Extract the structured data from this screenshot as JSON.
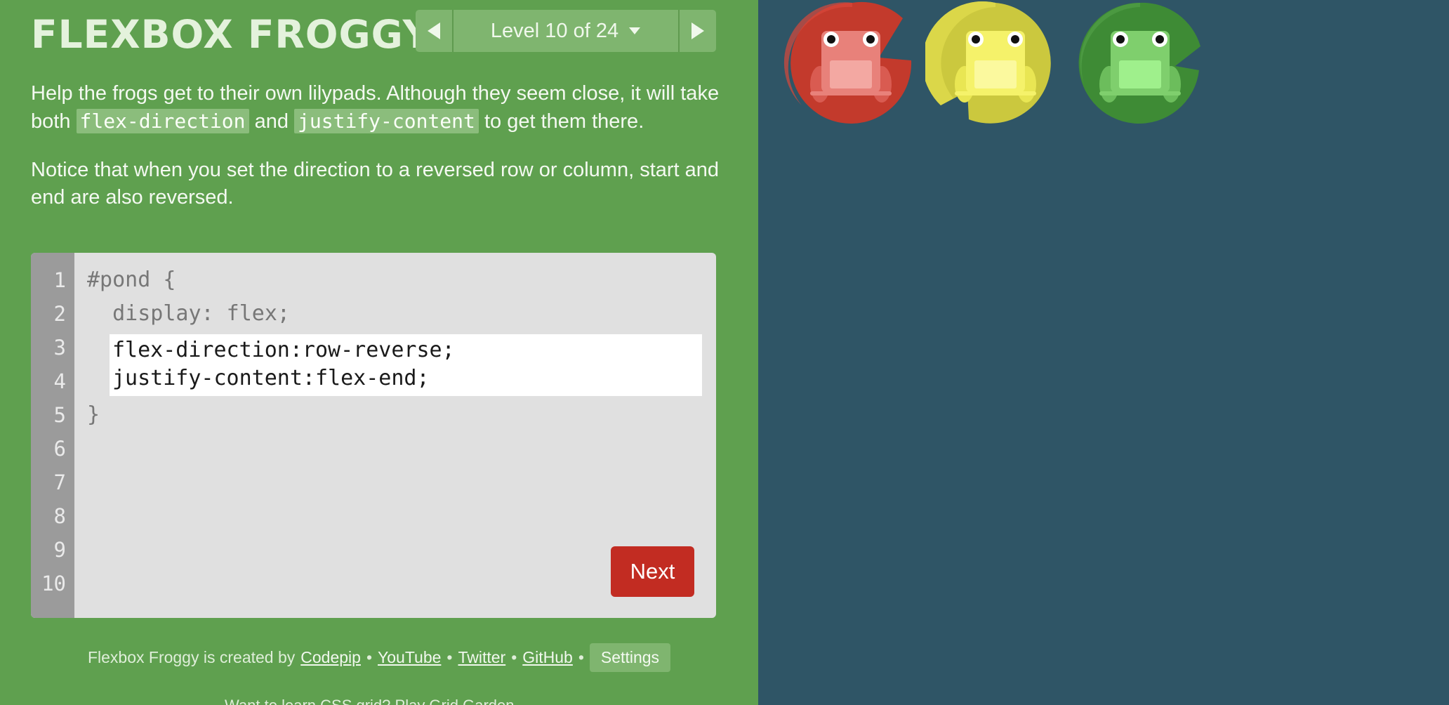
{
  "app": {
    "title": "FLEXBOX FROGGY"
  },
  "level_nav": {
    "label": "Level 10 of 24",
    "prev_icon": "triangle-left-icon",
    "next_icon": "triangle-right-icon",
    "dropdown_icon": "caret-down-icon"
  },
  "instructions": {
    "p1_part1": "Help the frogs get to their own lilypads. Although they seem close, it will take both ",
    "p1_code1": "flex-direction",
    "p1_and": " and ",
    "p1_code2": "justify-content",
    "p1_part2": " to get them there.",
    "p2": "Notice that when you set the direction to a reversed row or column, start and end are also reversed."
  },
  "editor": {
    "line_numbers": [
      "1",
      "2",
      "3",
      "4",
      "5",
      "6",
      "7",
      "8",
      "9",
      "10"
    ],
    "line1": "#pond {",
    "line2": "  display: flex;",
    "input_value": "flex-direction:row-reverse;\njustify-content:flex-end;",
    "closing": "}",
    "next_label": "Next"
  },
  "footer": {
    "created_by": "Flexbox Froggy is created by",
    "links": [
      "Codepip",
      "YouTube",
      "Twitter",
      "GitHub"
    ],
    "settings_label": "Settings",
    "partial_line": "Want to learn CSS grid? Play Grid Garden"
  },
  "pond": {
    "lilypads": [
      {
        "color": "red",
        "pad_hex": "#c33a2c",
        "frog_hex": "#e8817a"
      },
      {
        "color": "yellow",
        "pad_hex": "#cbc83e",
        "frog_hex": "#f5f26a"
      },
      {
        "color": "green",
        "pad_hex": "#3e8b35",
        "frog_hex": "#7fcf6d"
      }
    ]
  },
  "colors": {
    "sidebar": "#5fa04f",
    "pond": "#2f5566",
    "next_button": "#c22c22"
  }
}
